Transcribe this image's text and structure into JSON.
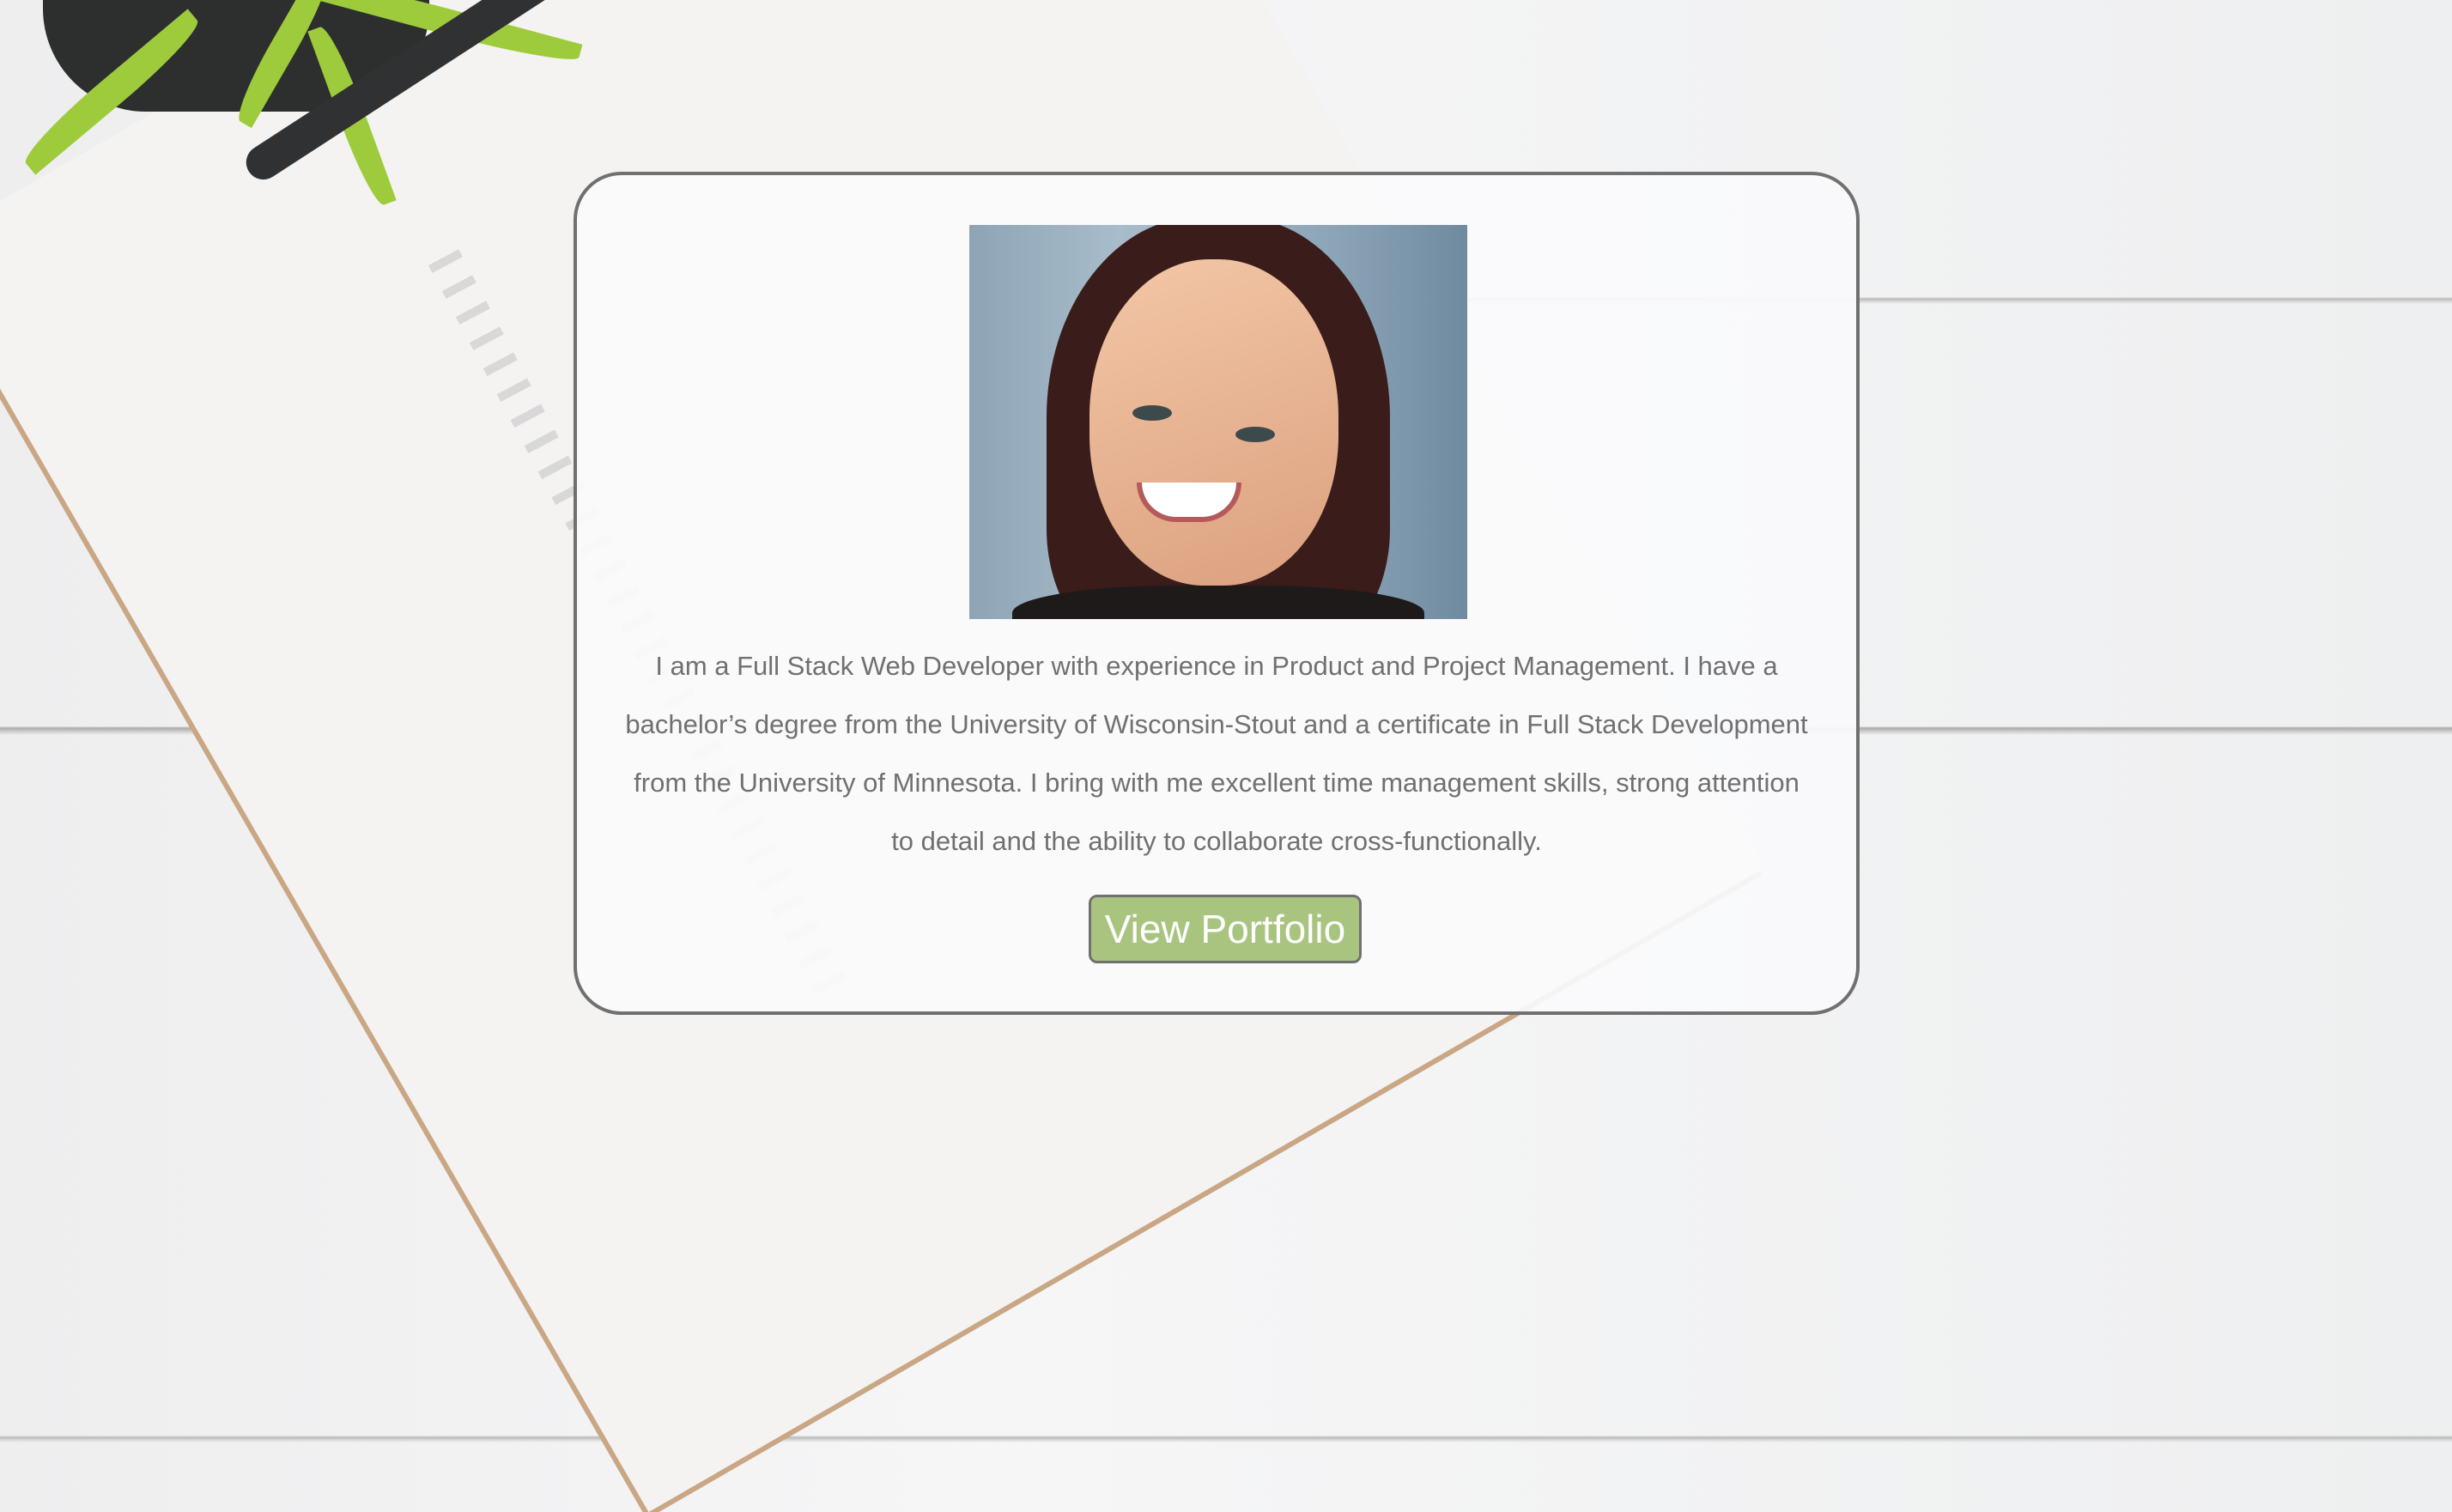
{
  "profile": {
    "photo_alt": "Profile photo",
    "bio": "I am a Full Stack Web Developer with experience in Product and Project Management. I have a bachelor’s degree from the University of Wisconsin-Stout and a certificate in Full Stack Development from the University of Minnesota. I bring with me excellent time management skills, strong attention to detail and the ability to collaborate cross-functionally.",
    "button_label": "View Portfolio"
  },
  "colors": {
    "button": "#a9c47f",
    "text": "#707070",
    "border": "#707070"
  }
}
